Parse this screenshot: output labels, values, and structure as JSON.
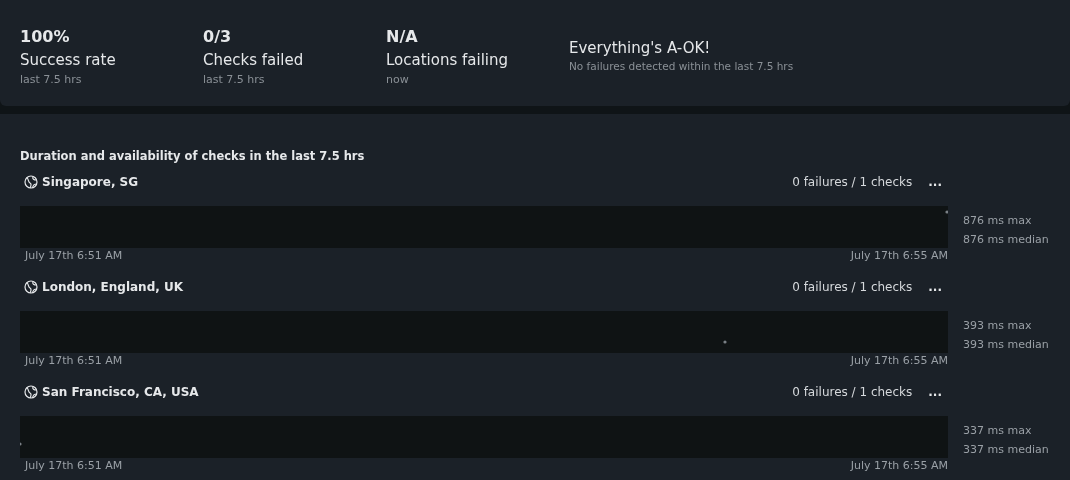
{
  "summary": [
    {
      "value": "100%",
      "label": "Success rate",
      "period": "last 7.5 hrs"
    },
    {
      "value": "0/3",
      "label": "Checks failed",
      "period": "last 7.5 hrs"
    },
    {
      "value": "N/A",
      "label": "Locations failing",
      "period": "now"
    }
  ],
  "status": {
    "title": "Everything's A-OK!",
    "message": "No failures detected within the last 7.5 hrs"
  },
  "section_title": "Duration and availability of checks in the last 7.5 hrs",
  "locations": [
    {
      "name": "Singapore, SG",
      "failures": "0 failures / 1 checks",
      "menu": "...",
      "start": "July 17th 6:51 AM",
      "end": "July 17th 6:55 AM",
      "max": "876 ms max",
      "median": "876 ms median"
    },
    {
      "name": "London, England, UK",
      "failures": "0 failures / 1 checks",
      "menu": "...",
      "start": "July 17th 6:51 AM",
      "end": "July 17th 6:55 AM",
      "max": "393 ms max",
      "median": "393 ms median"
    },
    {
      "name": "San Francisco, CA, USA",
      "failures": "0 failures / 1 checks",
      "menu": "...",
      "start": "July 17th 6:51 AM",
      "end": "July 17th 6:55 AM",
      "max": "337 ms max",
      "median": "337 ms median"
    }
  ]
}
